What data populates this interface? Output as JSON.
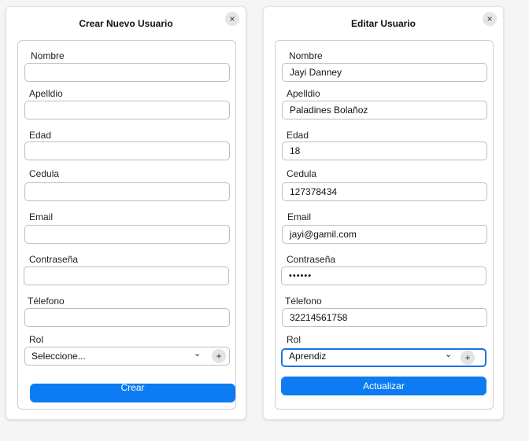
{
  "create_modal": {
    "title": "Crear Nuevo Usuario",
    "close_icon": "×",
    "labels": {
      "nombre": "Nombre",
      "apellido": "Apelldio",
      "edad": "Edad",
      "cedula": "Cedula",
      "email": "Email",
      "contrasena": "Contraseña",
      "telefono": "Télefono",
      "rol": "Rol"
    },
    "values": {
      "nombre": "",
      "apellido": "",
      "edad": "",
      "cedula": "",
      "email": "",
      "contrasena": "",
      "telefono": ""
    },
    "rol_selected": "Seleccione...",
    "chevron_icon": "⌄",
    "add_icon": "+",
    "submit_label": "Crear"
  },
  "edit_modal": {
    "title": "Editar Usuario",
    "close_icon": "×",
    "labels": {
      "nombre": "Nombre",
      "apellido": "Apelldio",
      "edad": "Edad",
      "cedula": "Cedula",
      "email": "Email",
      "contrasena": "Contraseña",
      "telefono": "Télefono",
      "rol": "Rol"
    },
    "values": {
      "nombre": "Jayi Danney",
      "apellido": "Paladines Bolañoz",
      "edad": " 18",
      "cedula": " 127378434",
      "email": "jayi@gamil.com",
      "contrasena": "••••••",
      "telefono": "32214561758"
    },
    "rol_selected": "Aprendiz",
    "chevron_icon": "⌄",
    "add_icon": "+",
    "submit_label": "Actualizar"
  },
  "colors": {
    "accent": "#0d7cf2",
    "focus_border": "#1a73e8"
  }
}
